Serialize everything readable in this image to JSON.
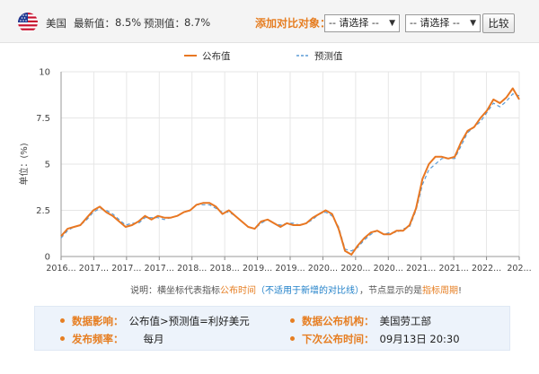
{
  "header": {
    "country": "美国",
    "latest_label": "最新值：",
    "latest_value": "8.5%",
    "forecast_label": "预测值：",
    "forecast_value": "8.7%",
    "compare_label": "添加对比对象：",
    "select1": "-- 请选择 --",
    "select2": "-- 请选择 --",
    "compare_button": "比较"
  },
  "chart_data": {
    "type": "line",
    "ylabel": "单位：(%)",
    "ylim": [
      0,
      10
    ],
    "yticks": [
      "0",
      "2.5",
      "5",
      "7.5",
      "10"
    ],
    "xtick_labels": [
      "2016...",
      "2017...",
      "2017...",
      "2017...",
      "2018...",
      "2018...",
      "2019...",
      "2019...",
      "2020...",
      "2020...",
      "2020...",
      "2021...",
      "2021...",
      "2022...",
      "202..."
    ],
    "grid": true,
    "legend_position": "top-center",
    "colors": {
      "actual": "#e87722",
      "forecast": "#5b9bd5"
    },
    "series": [
      {
        "name": "公布值",
        "values": [
          1.1,
          1.5,
          1.6,
          1.7,
          2.1,
          2.5,
          2.7,
          2.4,
          2.2,
          1.9,
          1.6,
          1.7,
          1.9,
          2.2,
          2.0,
          2.2,
          2.1,
          2.1,
          2.2,
          2.4,
          2.5,
          2.8,
          2.9,
          2.9,
          2.7,
          2.3,
          2.5,
          2.2,
          1.9,
          1.6,
          1.5,
          1.9,
          2.0,
          1.8,
          1.6,
          1.8,
          1.7,
          1.7,
          1.8,
          2.1,
          2.3,
          2.5,
          2.3,
          1.5,
          0.3,
          0.1,
          0.6,
          1.0,
          1.3,
          1.4,
          1.2,
          1.2,
          1.4,
          1.4,
          1.7,
          2.6,
          4.2,
          5.0,
          5.4,
          5.4,
          5.3,
          5.4,
          6.2,
          6.8,
          7.0,
          7.5,
          7.9,
          8.5,
          8.3,
          8.6,
          9.1,
          8.5
        ]
      },
      {
        "name": "预测值",
        "values": [
          1.0,
          1.4,
          1.6,
          1.7,
          2.0,
          2.4,
          2.6,
          2.5,
          2.3,
          2.0,
          1.7,
          1.8,
          1.8,
          2.1,
          2.1,
          2.1,
          2.0,
          2.1,
          2.2,
          2.4,
          2.5,
          2.8,
          2.8,
          2.8,
          2.6,
          2.4,
          2.4,
          2.2,
          1.9,
          1.6,
          1.5,
          1.8,
          2.0,
          1.8,
          1.7,
          1.8,
          1.8,
          1.7,
          1.8,
          2.0,
          2.3,
          2.4,
          2.2,
          1.6,
          0.4,
          0.3,
          0.5,
          0.9,
          1.2,
          1.4,
          1.2,
          1.3,
          1.3,
          1.5,
          1.6,
          2.5,
          3.9,
          4.7,
          5.0,
          5.3,
          5.3,
          5.3,
          6.0,
          6.7,
          7.0,
          7.3,
          7.8,
          8.3,
          8.1,
          8.4,
          8.8,
          8.7
        ]
      }
    ]
  },
  "note": {
    "prefix": "说明：横坐标代表指标",
    "publish_time": "公布时间",
    "paren": "（不适用于新增的对比线）",
    "middle": "，节点显示的是",
    "period": "指标周期",
    "suffix": "!"
  },
  "info": {
    "impact_label": "数据影响：",
    "impact_value": "公布值>预测值=利好美元",
    "agency_label": "数据公布机构：",
    "agency_value": "美国劳工部",
    "freq_label": "发布频率：",
    "freq_value": "每月",
    "next_label": "下次公布时间：",
    "next_value": "09月13日 20:30"
  }
}
